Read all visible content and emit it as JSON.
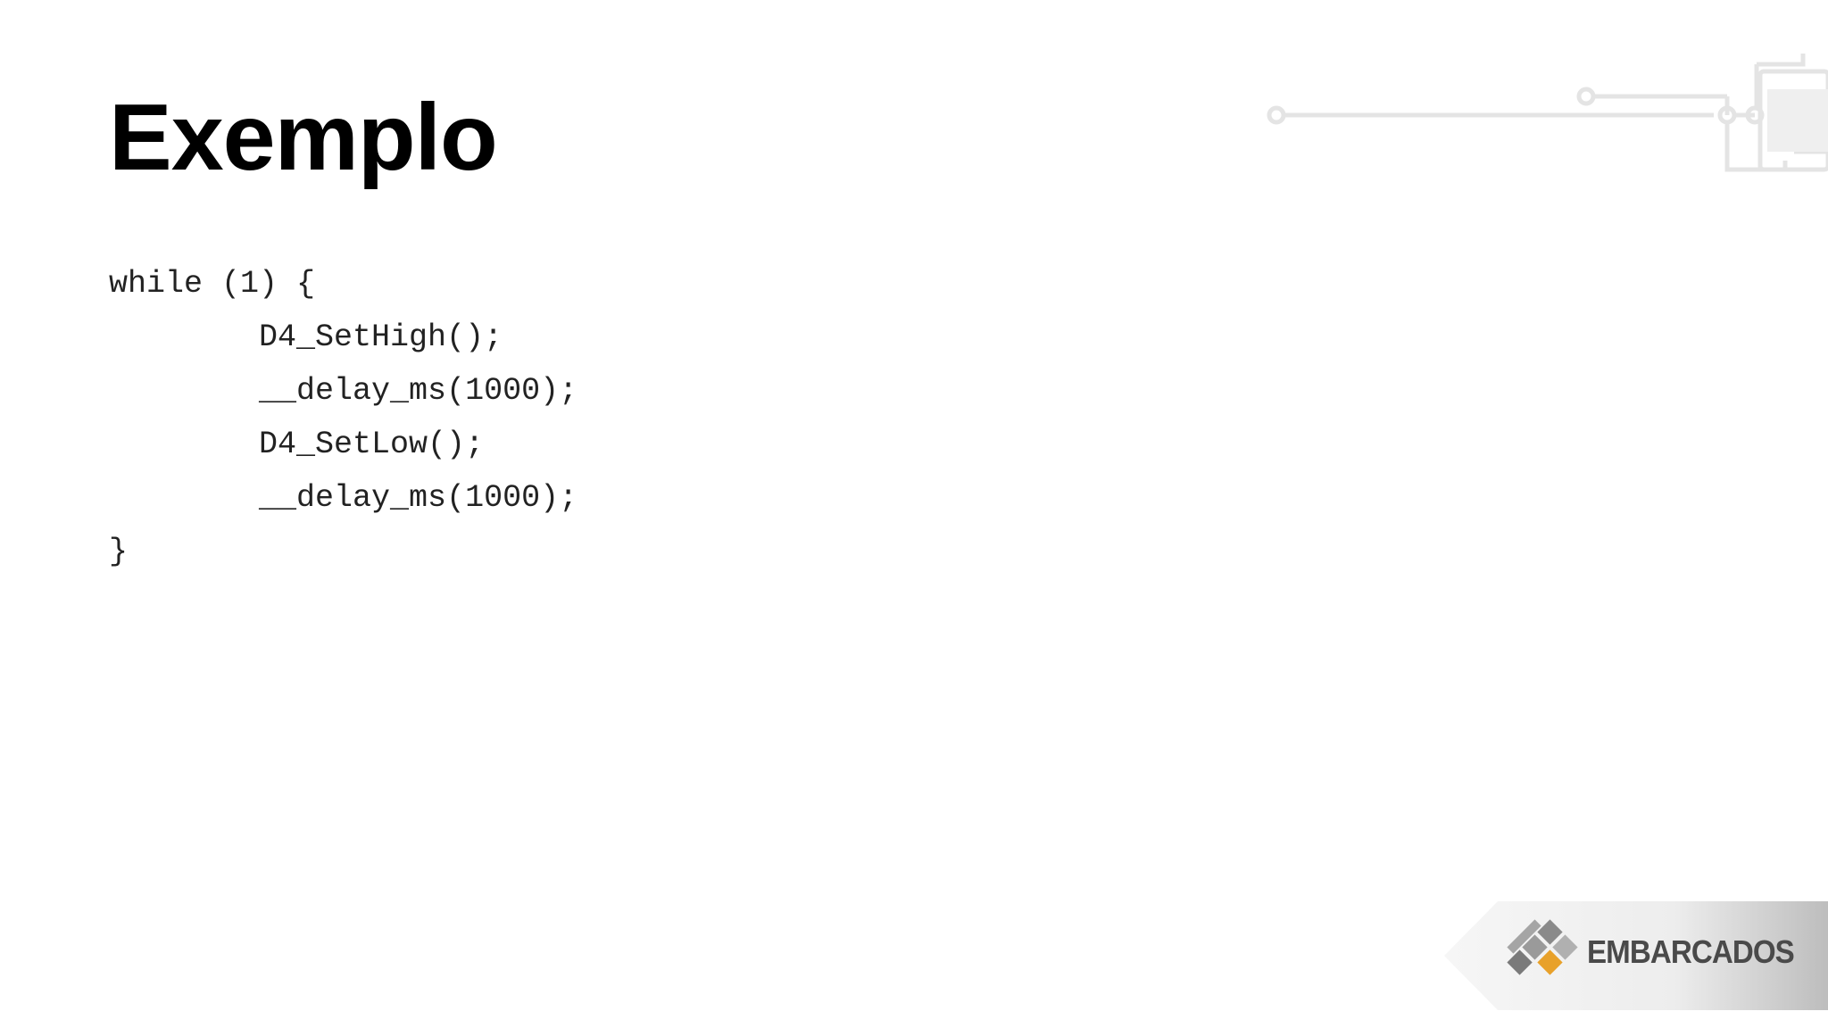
{
  "slide": {
    "title": "Exemplo",
    "code_lines": [
      "while (1) {",
      "        D4_SetHigh();",
      "        __delay_ms(1000);",
      "        D4_SetLow();",
      "        __delay_ms(1000);",
      "}"
    ]
  },
  "logo": {
    "text": "EMBARCADOS",
    "icon": "embarcados-logo-icon",
    "colors": {
      "accent": "#E8A12A",
      "gray": "#7a7a7a"
    }
  },
  "decoration": {
    "icon": "circuit-trace-icon",
    "color": "#e6e6e6"
  }
}
